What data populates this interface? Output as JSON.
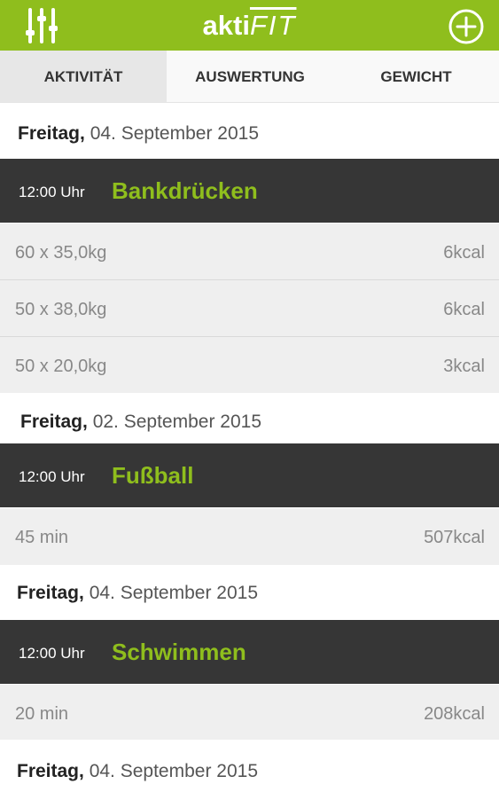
{
  "app": {
    "logo_bold": "akti",
    "logo_light": "FIT",
    "filter_icon": "sliders-icon",
    "add_icon": "plus-circle-icon",
    "accent_color": "#8fbe1d",
    "dark_color": "#363636"
  },
  "tabs": [
    {
      "label": "AKTIVITÄT",
      "active": true
    },
    {
      "label": "AUSWERTUNG",
      "active": false
    },
    {
      "label": "GEWICHT",
      "active": false
    }
  ],
  "groups": [
    {
      "date_day": "Freitag,",
      "date_rest": "04. September 2015",
      "time": "12:00 Uhr",
      "title": "Bankdrücken",
      "entries": [
        {
          "value": "60 x 35,0kg",
          "kcal": "6kcal"
        },
        {
          "value": "50 x 38,0kg",
          "kcal": "6kcal"
        },
        {
          "value": "50 x 20,0kg",
          "kcal": "3kcal"
        }
      ]
    },
    {
      "date_day": "Freitag,",
      "date_rest": "02. September 2015",
      "time": "12:00 Uhr",
      "title": "Fußball",
      "entries": [
        {
          "value": "45 min",
          "kcal": "507kcal"
        }
      ]
    },
    {
      "date_day": "Freitag,",
      "date_rest": "04. September 2015",
      "time": "12:00 Uhr",
      "title": "Schwimmen",
      "entries": [
        {
          "value": "20 min",
          "kcal": "208kcal"
        }
      ]
    },
    {
      "date_day": "Freitag,",
      "date_rest": "04. September 2015"
    }
  ]
}
